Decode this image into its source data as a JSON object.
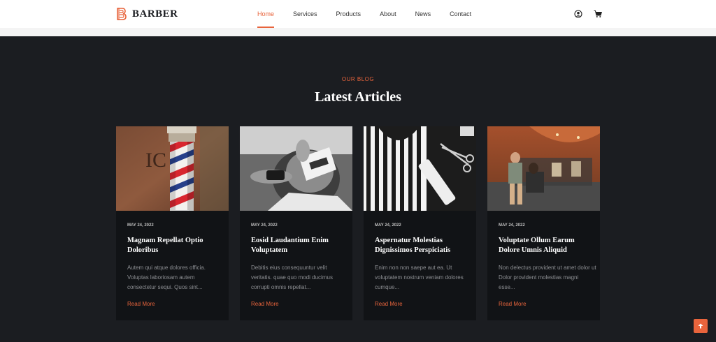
{
  "brand": {
    "name": "BARBER",
    "icon": "barber-logo-icon",
    "accent": "#e8643c"
  },
  "nav": {
    "items": [
      {
        "label": "Home",
        "active": true
      },
      {
        "label": "Services",
        "active": false
      },
      {
        "label": "Products",
        "active": false
      },
      {
        "label": "About",
        "active": false
      },
      {
        "label": "News",
        "active": false
      },
      {
        "label": "Contact",
        "active": false
      }
    ]
  },
  "header_icons": {
    "account": "user-icon",
    "cart": "cart-icon"
  },
  "blog": {
    "kicker": "OUR BLOG",
    "title": "Latest Articles",
    "read_more": "Read More",
    "posts": [
      {
        "date": "MAY 24, 2022",
        "title": "Magnam Repellat Optio Doloribus",
        "excerpt": "Autem qui atque dolores officia. Voluptas laboriosam autem consectetur sequi. Quos sint...",
        "image": "barber-pole-photo"
      },
      {
        "date": "MAY 24, 2022",
        "title": "Eosid Laudantium Enim Voluptatem",
        "excerpt": "Debitis eius consequuntur velit veritatis. quae quo modi ducimus corrupti omnis repellat...",
        "image": "beard-trim-photo"
      },
      {
        "date": "MAY 24, 2022",
        "title": "Aspernatur Molestias Dignissimos Perspiciatis",
        "excerpt": "Enim non non saepe aut ea. Ut voluptatem nostrum veniam dolores cumque...",
        "image": "barber-tools-photo"
      },
      {
        "date": "MAY 24, 2022",
        "title": "Voluptate Ollum Earum Dolore Umnis Aliquid",
        "excerpt": "Non delectus provident ut amet dolor ut Dolor provident molestias magni esse...",
        "image": "barbershop-interior-photo"
      }
    ]
  },
  "scroll_top": {
    "icon": "arrow-up-icon"
  }
}
